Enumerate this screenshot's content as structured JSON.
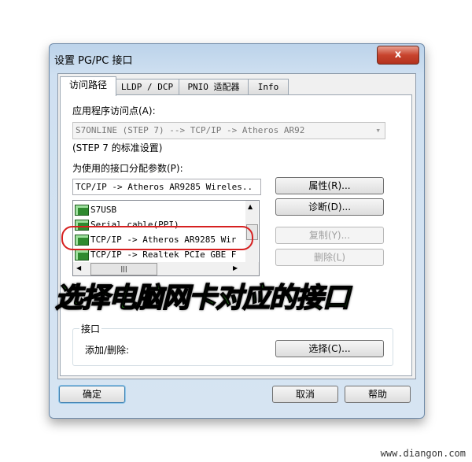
{
  "window": {
    "title": "设置 PG/PC 接口",
    "close": "x"
  },
  "tabs": [
    {
      "label": "访问路径"
    },
    {
      "label": "LLDP / DCP"
    },
    {
      "label": "PNIO 适配器"
    },
    {
      "label": "Info"
    }
  ],
  "access_point": {
    "label": "应用程序访问点(A):",
    "value": "S7ONLINE      (STEP 7)      --> TCP/IP -> Atheros AR92",
    "note": "(STEP 7 的标准设置)"
  },
  "interface_params": {
    "label": "为使用的接口分配参数(P):",
    "value": "TCP/IP -> Atheros AR9285 Wireles..",
    "items": [
      "S7USB",
      "Serial cable(PPI)",
      "TCP/IP -> Atheros AR9285 Wir",
      "TCP/IP -> Realtek PCIe GBE F"
    ],
    "highlighted_index": 2
  },
  "buttons": {
    "properties": "属性(R)...",
    "diagnostics": "诊断(D)...",
    "copy": "复制(Y)...",
    "delete": "删除(L)",
    "select": "选择(C)...",
    "ok": "确定",
    "cancel": "取消",
    "help": "帮助"
  },
  "interface_group": {
    "title": "接口",
    "add_remove": "添加/删除:"
  },
  "annotation": "选择电脑网卡对应的接口",
  "watermark": "www.diangon.com",
  "colors": {
    "annotation": "#33cc22",
    "highlight": "#d62020"
  }
}
